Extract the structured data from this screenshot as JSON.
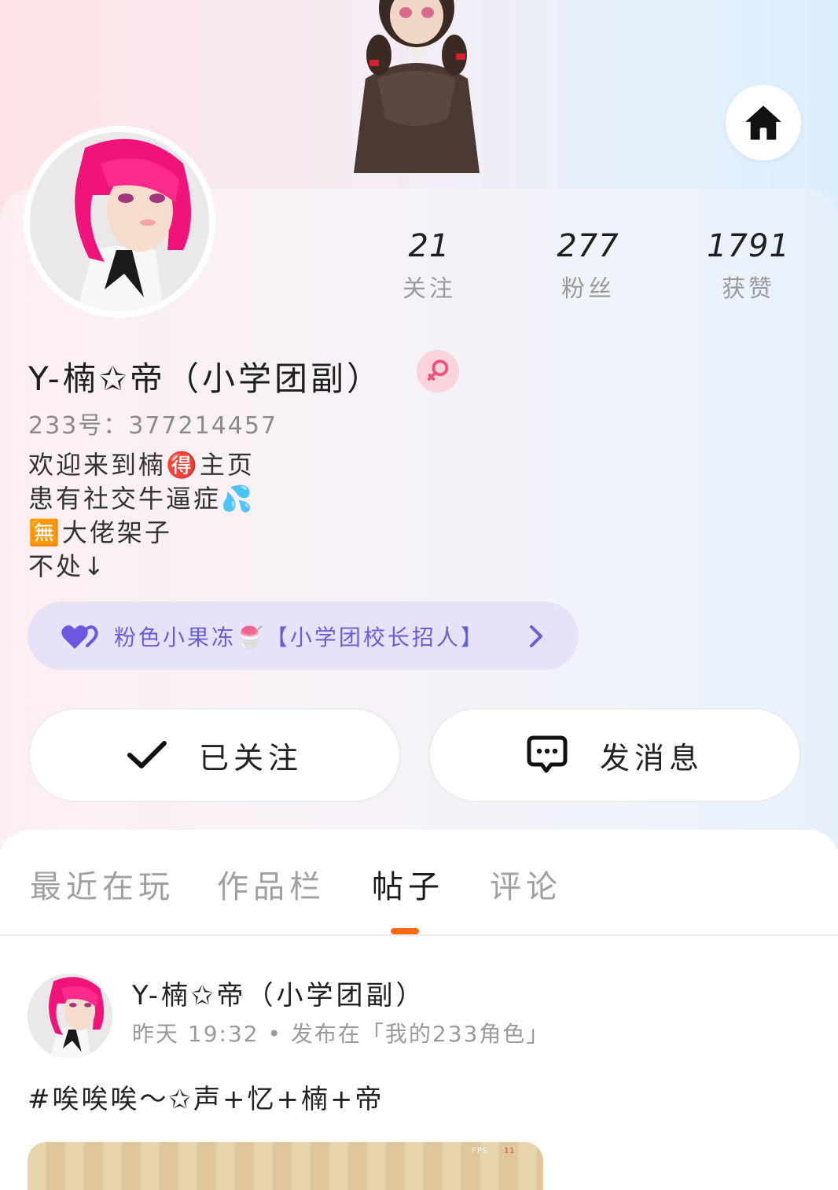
{
  "profile": {
    "stats": [
      {
        "num": "21",
        "label": "关注"
      },
      {
        "num": "277",
        "label": "粉丝"
      },
      {
        "num": "1791",
        "label": "获赞"
      }
    ],
    "username": "Y-楠✩帝（小学团副）",
    "uid": "233号：377214457",
    "bio": [
      "欢迎来到楠🉐主页",
      "患有社交牛逼症💦",
      "🈚大佬架子",
      "不处↓"
    ],
    "group_label": "粉色小果冻🍧【小学团校长招人】",
    "follow_label": "已关注",
    "message_label": "发消息"
  },
  "tabs": [
    {
      "label": "最近在玩",
      "active": false
    },
    {
      "label": "作品栏",
      "active": false
    },
    {
      "label": "帖子",
      "active": true
    },
    {
      "label": "评论",
      "active": false
    }
  ],
  "post": {
    "author": "Y-楠✩帝（小学团副）",
    "meta": "昨天 19:32 • 发布在「我的233角色」",
    "text": "#唉唉唉～✩声+忆+楠+帝",
    "fps_label": "FPS",
    "fps_value": "11"
  },
  "colors": {
    "accent": "#ff6a13",
    "group_text": "#6a5ed6",
    "group_bg": "#e7e2f8",
    "gender_badge": "#fbd3dc"
  },
  "icons": [
    "home-icon",
    "female-icon",
    "hearts-icon",
    "chevron-right-icon",
    "check-icon",
    "chat-bubble-icon"
  ]
}
